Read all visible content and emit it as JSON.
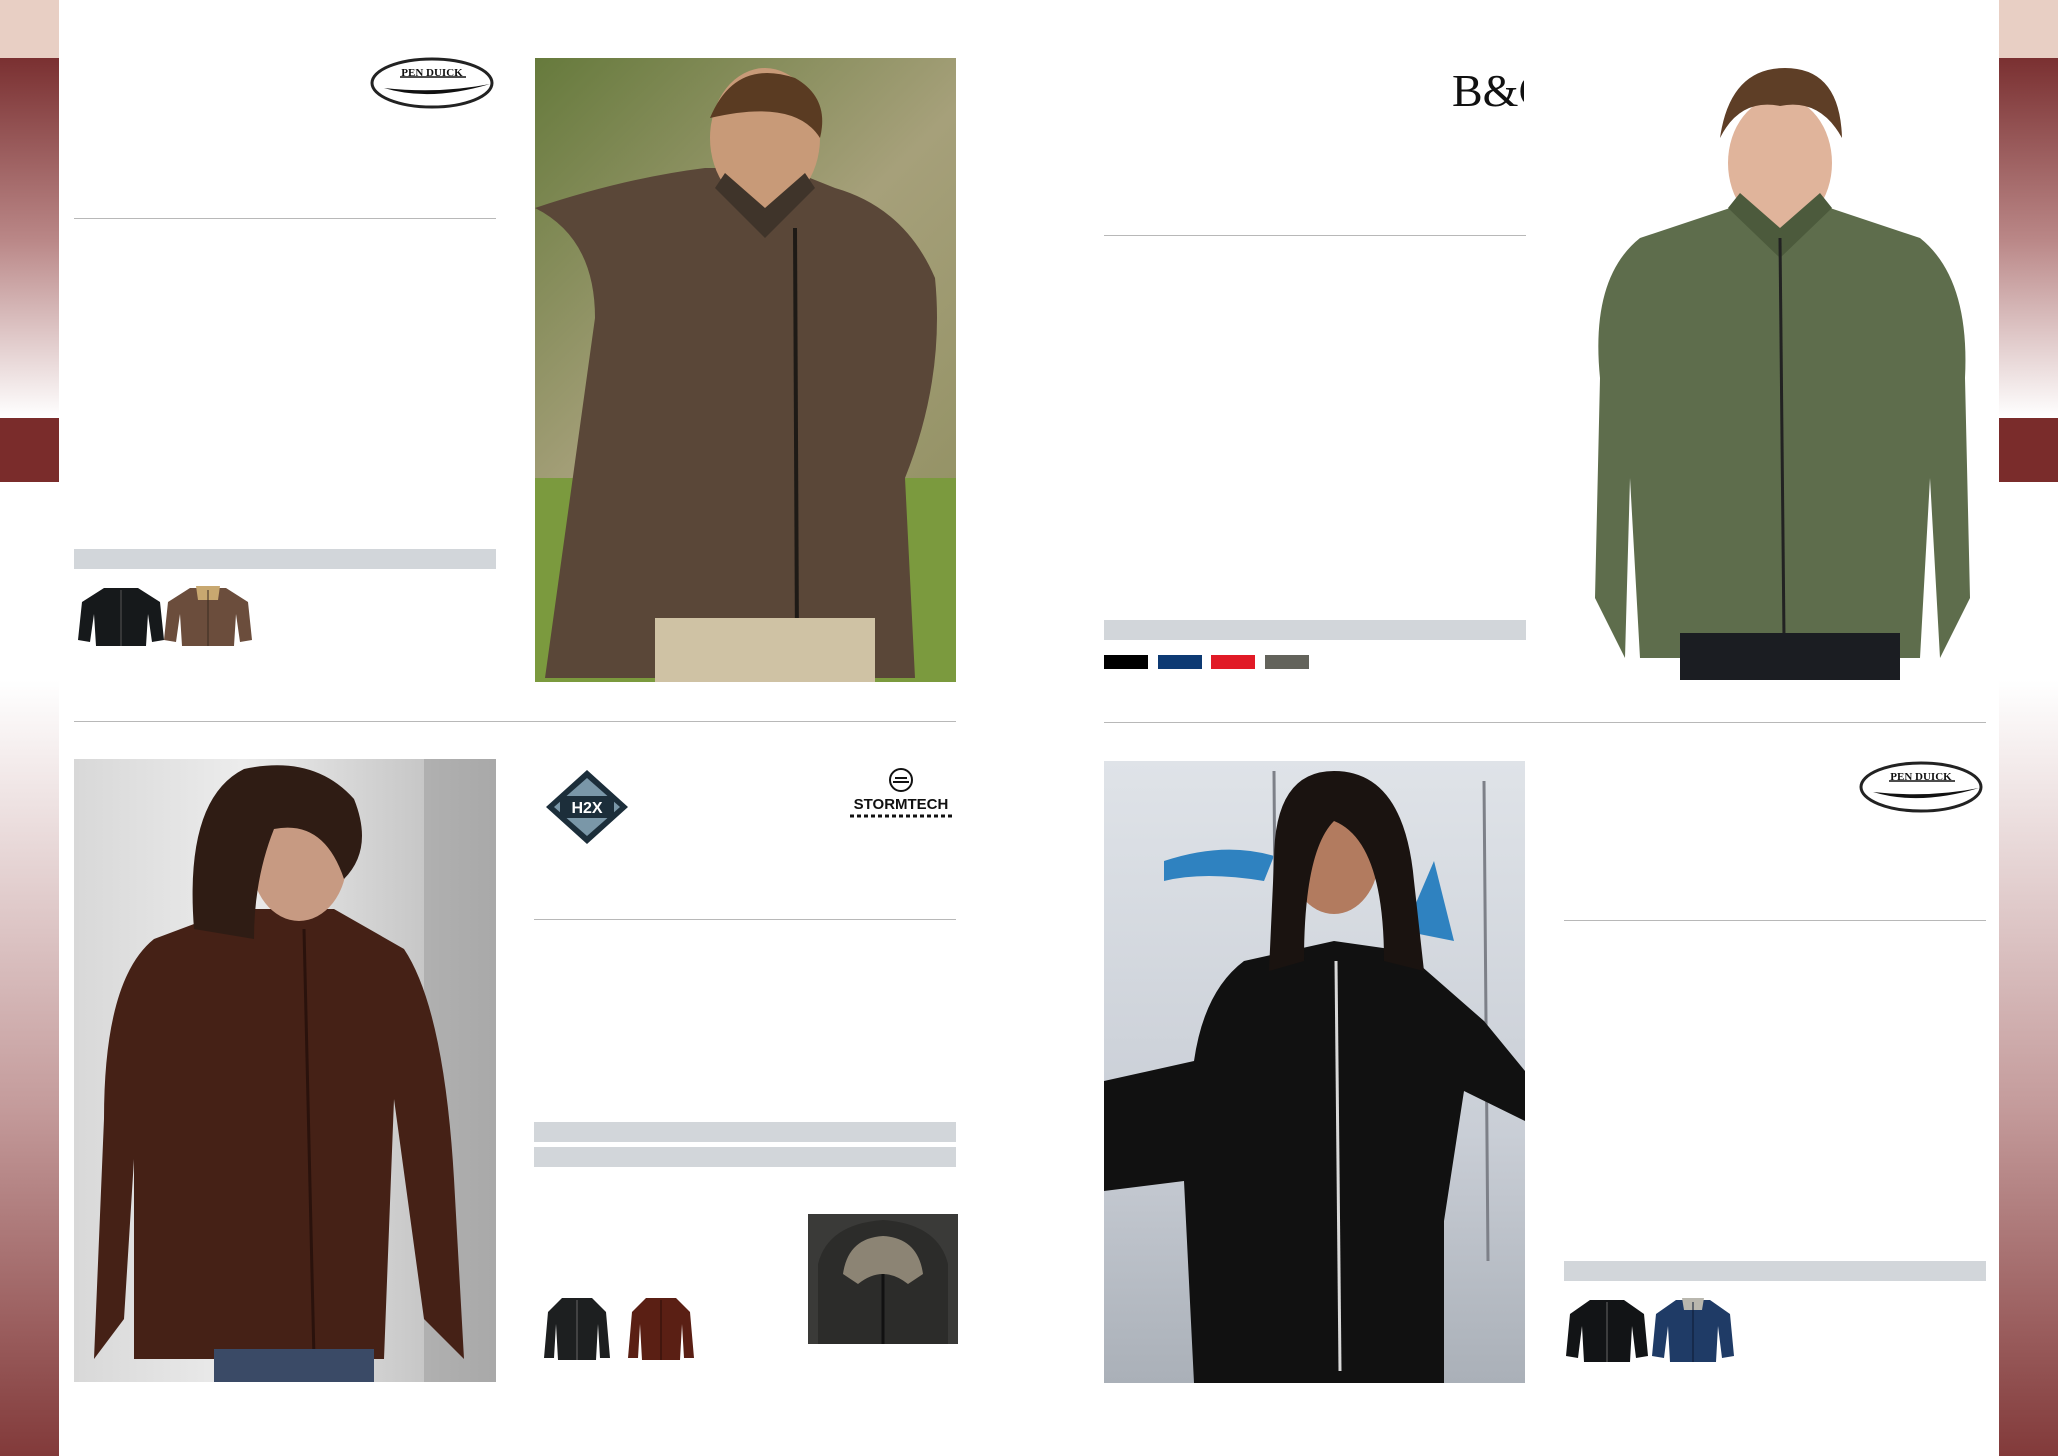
{
  "brands": {
    "pen_duick_1": "PEN DUICK",
    "pen_duick_2": "PEN DUICK",
    "bc": "B&C",
    "h2x": "H2X",
    "stormtech": "STORMTECH"
  },
  "colors": {
    "band_dark": "#7a2c2b",
    "band_light": "#e8cfc4",
    "grey_bar": "#d2d6da",
    "swatch_black": "#000000",
    "swatch_navy": "#0d3a73",
    "swatch_red": "#e11a26",
    "swatch_grey": "#63635b"
  },
  "products": [
    {
      "jacket_colors": [
        "black",
        "brown"
      ]
    },
    {
      "jacket_colors": [
        "black",
        "navy",
        "red",
        "grey"
      ]
    },
    {
      "jacket_colors": [
        "black",
        "brown"
      ]
    },
    {
      "jacket_colors": [
        "black",
        "navy"
      ]
    }
  ]
}
